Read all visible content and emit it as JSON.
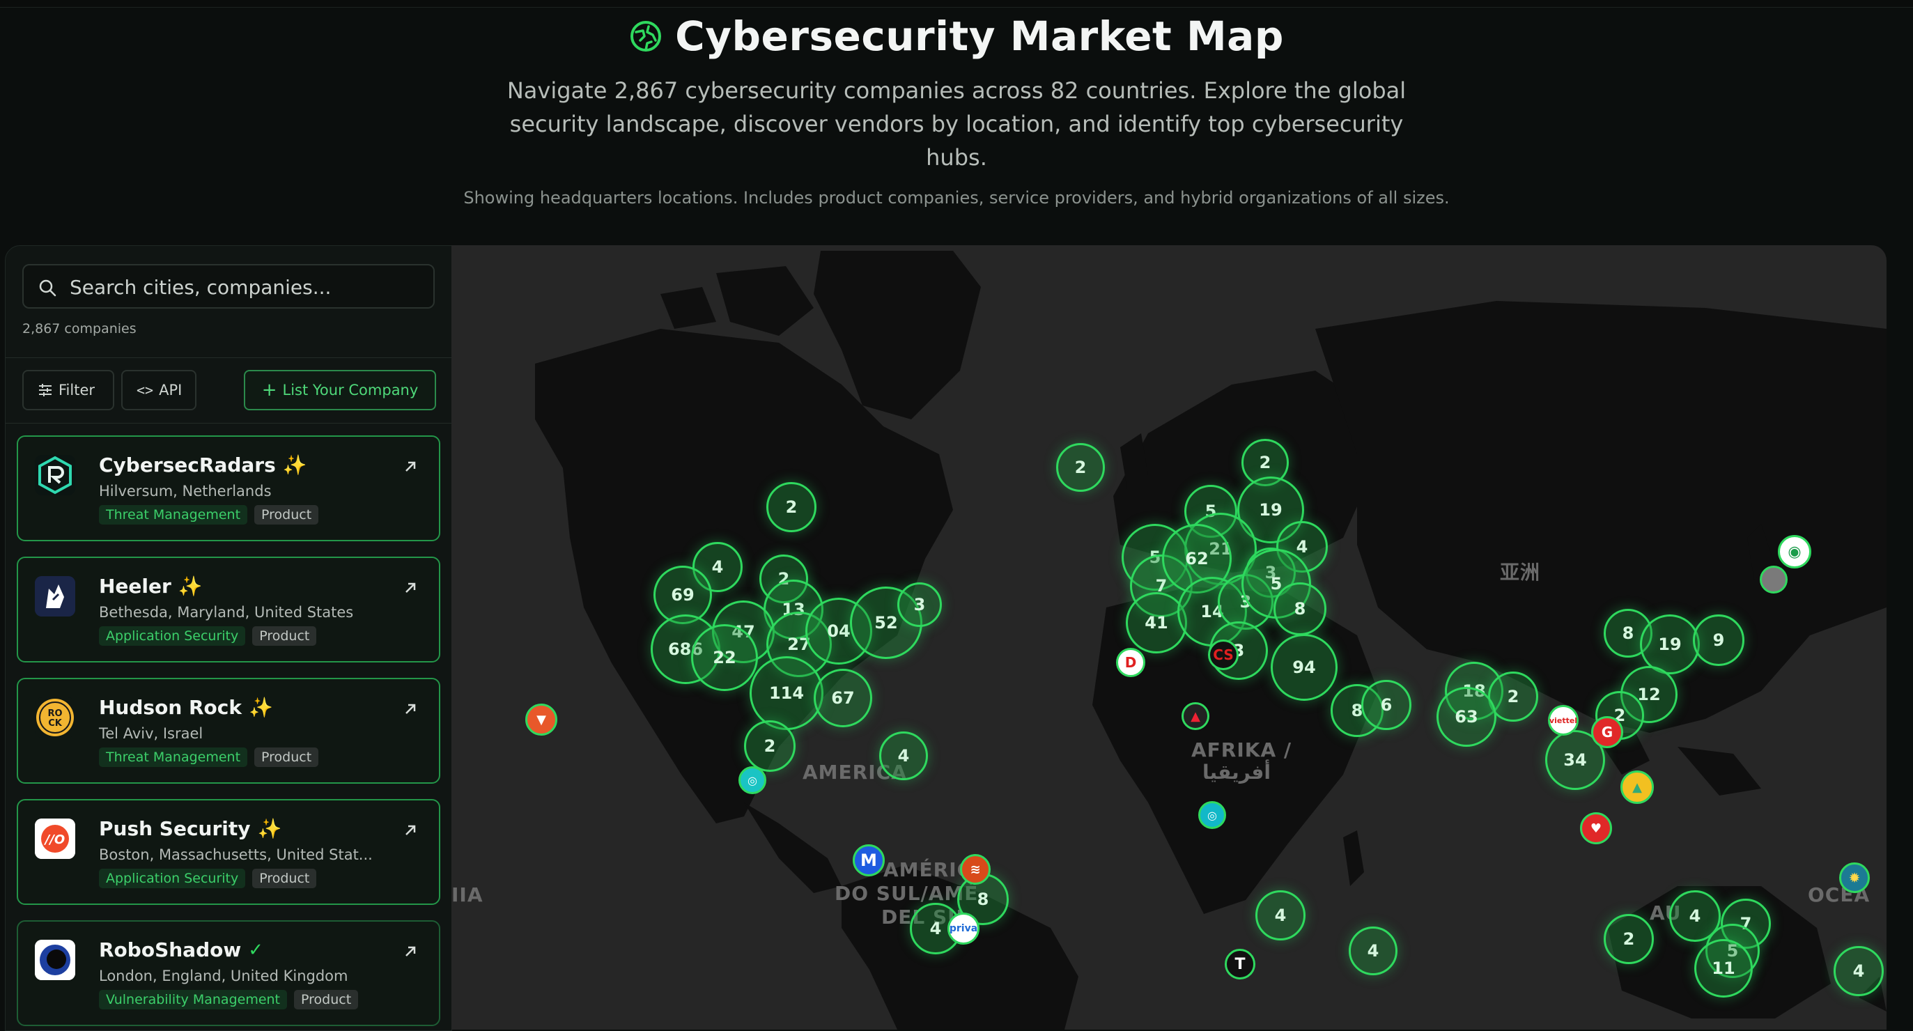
{
  "header": {
    "title": "Cybersecurity Market Map",
    "subtitle": "Navigate 2,867 cybersecurity companies across 82 countries. Explore the global security landscape, discover vendors by location, and identify top cybersecurity hubs.",
    "note": "Showing headquarters locations. Includes product companies, service providers, and hybrid organizations of all sizes."
  },
  "sidebar": {
    "search_placeholder": "Search cities, companies...",
    "count": "2,867 companies",
    "filter_label": "Filter",
    "api_label": "API",
    "list_label": "List Your Company",
    "cards": [
      {
        "name": "CybersecRadars",
        "location": "Hilversum, Netherlands",
        "category": "Threat Management",
        "type": "Product"
      },
      {
        "name": "Heeler",
        "location": "Bethesda, Maryland, United States",
        "category": "Application Security",
        "type": "Product"
      },
      {
        "name": "Hudson Rock",
        "location": "Tel Aviv, Israel",
        "category": "Threat Management",
        "type": "Product"
      },
      {
        "name": "Push Security",
        "location": "Boston, Massachusetts, United Stat...",
        "category": "Application Security",
        "type": "Product"
      },
      {
        "name": "RoboShadow",
        "location": "London, England, United Kingdom",
        "category": "Vulnerability Management",
        "type": "Product"
      }
    ]
  },
  "map": {
    "labels": {
      "asia": "亚洲",
      "africa1": "AFRIKA /",
      "africa2": "أفريقيا",
      "samerica1": "AMÉRICA",
      "samerica2": "DO SUL/AMÉ",
      "samerica3": "DEL SU",
      "namerica": "AMERICA",
      "oceania": "OCEA",
      "australia": "AU",
      "left": "IIA"
    },
    "clusters": [
      "2",
      "2",
      "2",
      "4",
      "69",
      "2",
      "13",
      "686",
      "47",
      "27",
      "04",
      "52",
      "3",
      "22",
      "114",
      "67",
      "2",
      "4",
      "5",
      "19",
      "21",
      "4",
      "3",
      "5",
      "7",
      "62",
      "41",
      "14",
      "3",
      "5",
      "8",
      "3",
      "94",
      "8",
      "6",
      "18",
      "2",
      "63",
      "8",
      "19",
      "9",
      "12",
      "2",
      "34",
      "4",
      "2",
      "4",
      "7",
      "5",
      "11",
      "8",
      "4",
      "4",
      "2",
      "2",
      "4"
    ]
  },
  "colors": {
    "accent": "#2fd95e",
    "background": "#0b0e0d",
    "map": "#262626"
  }
}
